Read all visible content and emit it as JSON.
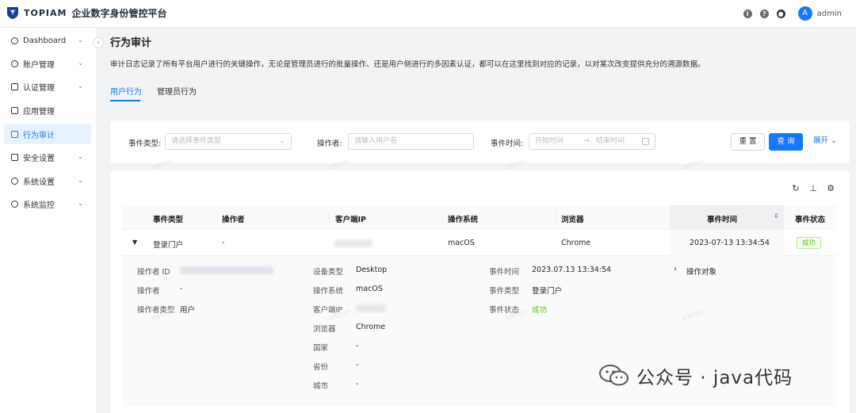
{
  "app": {
    "brand": "TOPIAM",
    "title": "企业数字身份管控平台",
    "user": "admin",
    "avatar_letter": "A"
  },
  "sidebar": {
    "items": [
      {
        "label": "Dashboard",
        "icon": "dashboard-icon"
      },
      {
        "label": "账户管理",
        "icon": "user-icon"
      },
      {
        "label": "认证管理",
        "icon": "shield-icon"
      },
      {
        "label": "应用管理",
        "icon": "apps-icon"
      },
      {
        "label": "行为审计",
        "icon": "audit-icon"
      },
      {
        "label": "安全设置",
        "icon": "security-icon"
      },
      {
        "label": "系统设置",
        "icon": "settings-icon"
      },
      {
        "label": "系统监控",
        "icon": "monitor-icon"
      }
    ]
  },
  "page": {
    "title": "行为审计",
    "description": "审计日志记录了所有平台用户进行的关键操作，无论是管理员进行的批量操作、还是用户侧进行的多因素认证，都可以在这里找到对应的记录，以对某次改变提供充分的溯源数据。",
    "tabs": [
      "用户行为",
      "管理员行为"
    ]
  },
  "filter": {
    "event_type_label": "事件类型:",
    "event_type_placeholder": "请选择事件类型",
    "operator_label": "操作者:",
    "operator_placeholder": "请输入用户名",
    "time_label": "事件时间:",
    "time_start": "开始时间",
    "time_end": "结束时间",
    "reset": "重 置",
    "search": "查 询",
    "expand": "展开"
  },
  "table": {
    "columns": [
      "事件类型",
      "操作者",
      "客户端IP",
      "操作系统",
      "浏览器",
      "事件时间",
      "事件状态"
    ],
    "rows": [
      {
        "event_type": "登录门户",
        "operator": "-",
        "os": "macOS",
        "browser": "Chrome",
        "time": "2023-07-13 13:34:54",
        "status": "成功"
      }
    ]
  },
  "detail": {
    "col1": [
      {
        "label": "操作者 ID",
        "value": ""
      },
      {
        "label": "操作者",
        "value": "-"
      },
      {
        "label": "操作者类型",
        "value": "用户"
      }
    ],
    "col2": [
      {
        "label": "设备类型",
        "value": "Desktop"
      },
      {
        "label": "操作系统",
        "value": "macOS"
      },
      {
        "label": "客户端IP",
        "value": ""
      },
      {
        "label": "浏览器",
        "value": "Chrome"
      },
      {
        "label": "国家",
        "value": "-"
      },
      {
        "label": "省份",
        "value": "-"
      },
      {
        "label": "城市",
        "value": "-"
      }
    ],
    "col3": [
      {
        "label": "事件时间",
        "value": "2023.07.13 13:34:54"
      },
      {
        "label": "事件类型",
        "value": "登录门户"
      },
      {
        "label": "事件状态",
        "value": "成功"
      }
    ],
    "target_label": "操作对象"
  },
  "watermark": "admin",
  "overlay": {
    "text": "公众号 · java代码"
  }
}
